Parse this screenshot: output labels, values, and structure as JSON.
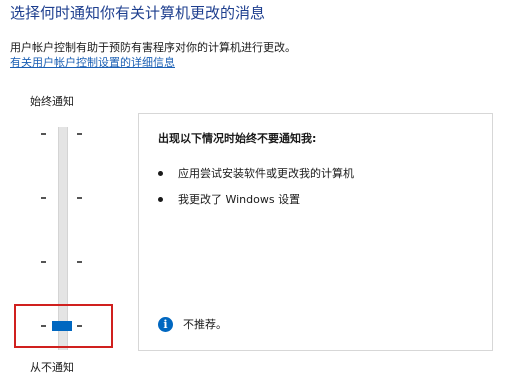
{
  "header": {
    "title": "选择何时通知你有关计算机更改的消息",
    "description": "用户帐户控制有助于预防有害程序对你的计算机进行更改。",
    "link_text": "有关用户帐户控制设置的详细信息"
  },
  "slider": {
    "top_label": "始终通知",
    "bottom_label": "从不通知",
    "levels": 4,
    "selected_level": 1,
    "selected_description": "bottom (never notify)"
  },
  "panel": {
    "heading": "出现以下情况时始终不要通知我:",
    "bullets": [
      "应用尝试安装软件或更改我的计算机",
      "我更改了 Windows 设置"
    ],
    "note": "不推荐。",
    "note_icon": "info-icon"
  },
  "colors": {
    "title": "#1e3f8f",
    "link": "#1a5fb4",
    "thumb": "#0067c0",
    "highlight": "#d0201e",
    "info_icon": "#0067c0"
  }
}
